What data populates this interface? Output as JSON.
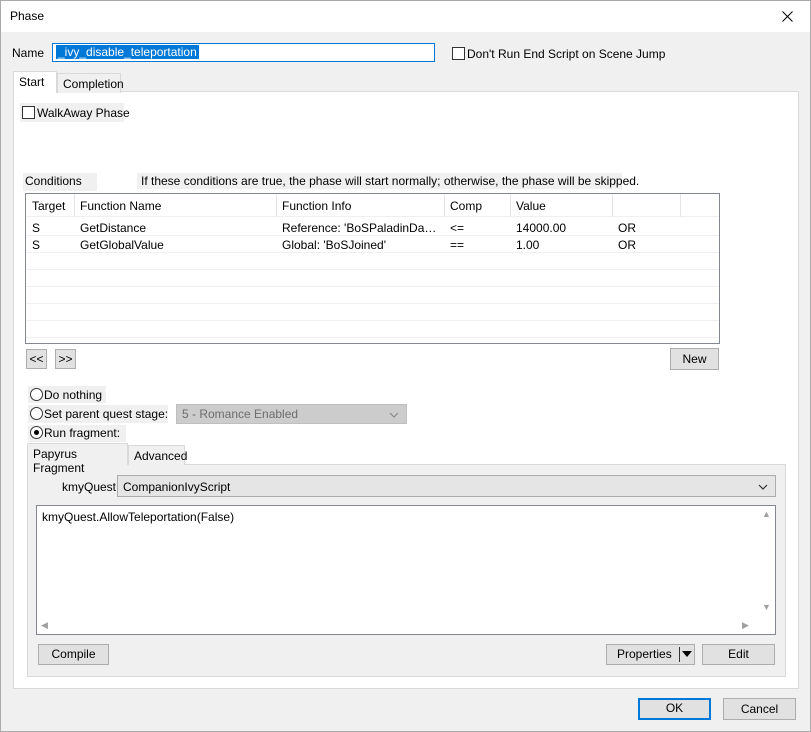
{
  "window": {
    "title": "Phase"
  },
  "name_field": {
    "label": "Name",
    "value": "_ivy_disable_teleportation"
  },
  "dont_run_end_script": {
    "label": "Don't Run End Script on Scene Jump",
    "checked": false
  },
  "tabs": [
    {
      "label": "Start",
      "active": true
    },
    {
      "label": "Completion",
      "active": false
    }
  ],
  "walkaway": {
    "label": "WalkAway Phase",
    "checked": false
  },
  "conditions": {
    "label": "Conditions",
    "description": "If these conditions are true, the phase will start normally; otherwise, the phase will be skipped.",
    "columns": [
      "Target",
      "Function Name",
      "Function Info",
      "Comp",
      "Value",
      ""
    ],
    "rows": [
      {
        "target": "S",
        "function_name": "GetDistance",
        "function_info": "Reference: 'BoSPaladinDanse...",
        "comp": "<=",
        "value": "14000.00",
        "op": "OR"
      },
      {
        "target": "S",
        "function_name": "GetGlobalValue",
        "function_info": "Global: 'BoSJoined'",
        "comp": "==",
        "value": "1.00",
        "op": "OR"
      }
    ],
    "prev_label": "<<",
    "next_label": ">>",
    "new_label": "New"
  },
  "action": {
    "do_nothing_label": "Do nothing",
    "set_stage_label": "Set parent quest stage:",
    "stage_value": "5 - Romance Enabled",
    "run_fragment_label": "Run fragment:",
    "selected": "run_fragment"
  },
  "fragment_tabs": [
    {
      "label": "Papyrus Fragment",
      "active": true
    },
    {
      "label": "Advanced",
      "active": false
    }
  ],
  "fragment": {
    "quest_label": "kmyQuest",
    "quest_value": "CompanionIvyScript",
    "code": "kmyQuest.AllowTeleportation(False)",
    "compile_label": "Compile",
    "properties_label": "Properties",
    "edit_label": "Edit"
  },
  "dialog_buttons": {
    "ok_label": "OK",
    "cancel_label": "Cancel"
  }
}
